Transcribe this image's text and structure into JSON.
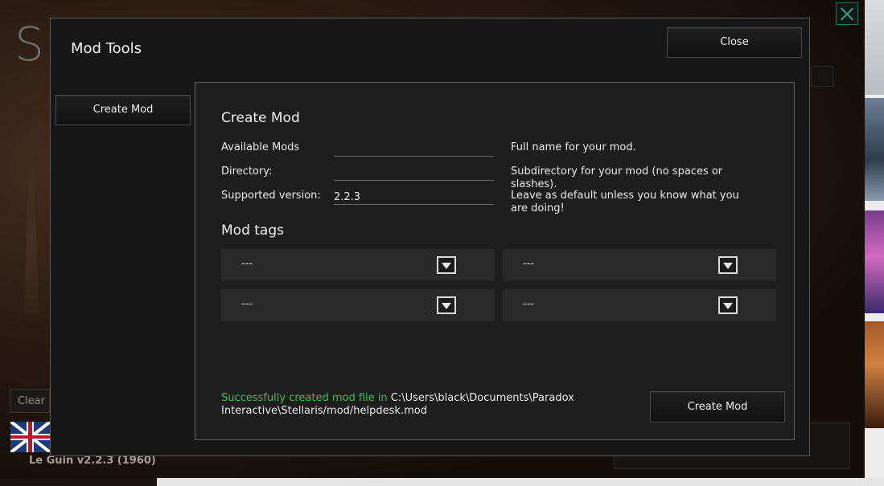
{
  "background": {
    "logo_letter": "S",
    "clear_label": "Clear",
    "version": "Le Guin v2.2.3 (1960)"
  },
  "modal": {
    "title": "Mod Tools",
    "close_label": "Close",
    "sidebar_create_label": "Create Mod"
  },
  "form": {
    "title": "Create Mod",
    "fields": [
      {
        "label": "Available Mods",
        "value": "",
        "help": "Full name for your mod."
      },
      {
        "label": "Directory:",
        "value": "",
        "help": "Subdirectory for your mod (no spaces or slashes)."
      },
      {
        "label": "Supported version:",
        "value": "2.2.3",
        "help": "Leave as default unless you know what you are doing!"
      }
    ],
    "tags_title": "Mod tags",
    "tags": [
      "---",
      "---",
      "---",
      "---"
    ],
    "status_ok": "Successfully created mod file in",
    "status_path": "C:\\Users\\black\\Documents\\Paradox Interactive\\Stellaris/mod/helpdesk.mod",
    "create_label": "Create Mod"
  },
  "colors": {
    "success": "#39c24a",
    "modal_bg": "#171717",
    "panel_bg": "#1e1e1e"
  }
}
